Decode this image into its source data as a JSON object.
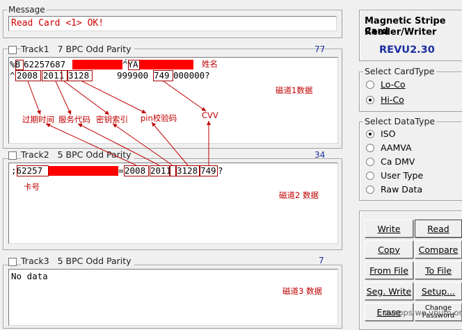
{
  "message": {
    "legend": "Message",
    "value": "Read Card <1> OK!"
  },
  "track1": {
    "label": "Track1",
    "info": "7 BPC  Odd Parity",
    "count": "77",
    "line1_prefix": "%B",
    "line1_a": "62257687",
    "line1_b": "^YA",
    "line2_prefix": "^",
    "line2_a": "2008",
    "line2_b": "2011",
    "line2_c": "3128",
    "line2_d": "999900",
    "line2_e": "749",
    "line2_f": "000000?",
    "name_note": "姓名",
    "track_note": "磁道1数据"
  },
  "annotations": {
    "expiry": "过期时间",
    "service_code": "服务代码",
    "key_index": "密钥索引",
    "pin_check": "pin校验码",
    "cvv": "CVV",
    "card_no": "卡号"
  },
  "track2": {
    "label": "Track2",
    "info": "5 BPC  Odd Parity",
    "count": "34",
    "l_a": ";62257",
    "l_b": "=",
    "l_c": "2008",
    "l_d": "2011",
    "l_e": "3128",
    "l_f": "749",
    "l_g": "?",
    "track_note": "磁道2 数据"
  },
  "track3": {
    "label": "Track3",
    "info": "5 BPC  Odd Parity",
    "count": "7",
    "value": "No data",
    "track_note": "磁道3 数据"
  },
  "device": {
    "title_line1": "Magnetic Stripe Card",
    "title_line2": "Reader/Writer",
    "model": "REVU2.30"
  },
  "card_type": {
    "legend": "Select CardType",
    "options": [
      "Lo-Co",
      "Hi-Co"
    ],
    "selected": "Hi-Co"
  },
  "data_type": {
    "legend": "Select DataType",
    "options": [
      "ISO",
      "AAMVA",
      "Ca DMV",
      "User Type",
      "Raw Data"
    ],
    "selected": "ISO"
  },
  "buttons": {
    "write": "Write",
    "read": "Read",
    "copy": "Copy",
    "compare": "Compare",
    "from_file": "From File",
    "to_file": "To File",
    "seg_write": "Seg. Write",
    "setup": "Setup...",
    "erase": "Erase",
    "change_password_1": "Change",
    "change_password_2": "Password"
  },
  "watermark": "pvspps.wo.vnum.org"
}
